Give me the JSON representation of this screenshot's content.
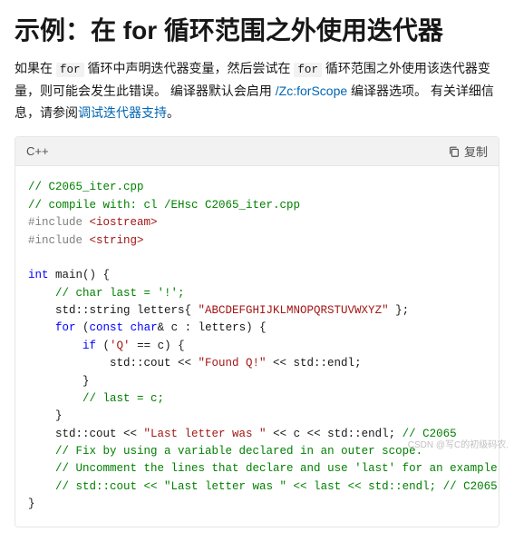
{
  "heading": {
    "prefix": "示例：在 ",
    "kw": "for",
    "suffix": " 循环范围之外使用迭代器"
  },
  "intro": {
    "seg1": "如果在 ",
    "kw1": "for",
    "seg2": " 循环中声明迭代器变量，然后尝试在 ",
    "kw2": "for",
    "seg3": " 循环范围之外使用该迭代器变量，则可能会发生此错误。 编译器默认会启用 ",
    "opt_link": "/Zc:forScope",
    "seg4": " 编译器选项。 有关详细信息，请参阅",
    "link2": "调试迭代器支持",
    "seg5": "。"
  },
  "code_header": {
    "lang": "C++",
    "copy": "复制"
  },
  "code": {
    "c1": "// C2065_iter.cpp",
    "c2": "// compile with: cl /EHsc C2065_iter.cpp",
    "inc1a": "#include ",
    "inc1b": "<iostream>",
    "inc2a": "#include ",
    "inc2b": "<string>",
    "kw_int": "int",
    "main_sig": " main() {",
    "c3": "// char last = '!';",
    "l_letters_a": "    std::string letters{ ",
    "l_letters_str": "\"ABCDEFGHIJKLMNOPQRSTUVWXYZ\"",
    "l_letters_b": " };",
    "kw_for": "for",
    "for_open": " (",
    "kw_const": "const",
    "for_mid": " ",
    "kw_char": "char",
    "for_tail": "& c : letters) {",
    "kw_if": "if",
    "if_open": " (",
    "if_q": "'Q'",
    "if_tail": " == c) {",
    "cout_found_a": "            std::cout << ",
    "cout_found_str": "\"Found Q!\"",
    "cout_found_b": " << std::endl;",
    "brace_close3": "        }",
    "c4": "// last = c;",
    "brace_close2": "    }",
    "cout_last_a": "    std::cout << ",
    "cout_last_str": "\"Last letter was \"",
    "cout_last_b": " << c << std::endl; ",
    "c5": "// C2065",
    "c6": "// Fix by using a variable declared in an outer scope.",
    "c7": "// Uncomment the lines that declare and use 'last' for an example.",
    "c8": "// std::cout << \"Last letter was \" << last << std::endl; // C2065",
    "brace_close1": "}"
  },
  "watermark": "CSDN @写C的初级码农."
}
